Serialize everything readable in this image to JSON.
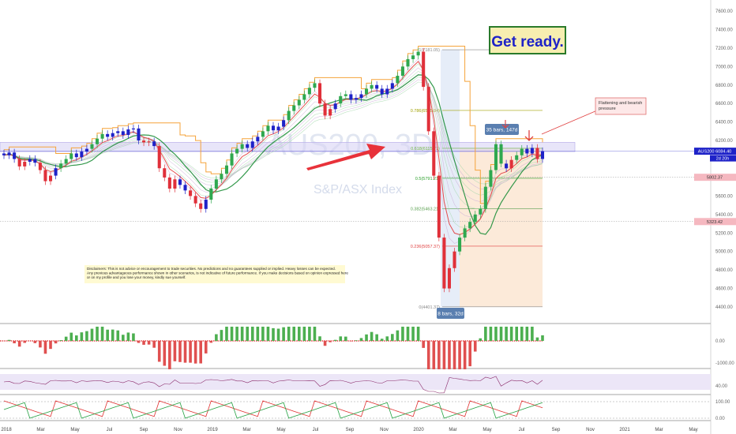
{
  "chart_data": {
    "type": "candlestick",
    "watermark": {
      "symbol": "AUS200, 3D",
      "name": "S&P/ASX Index"
    },
    "y_axis": {
      "ticks": [
        "7600.00",
        "7400.00",
        "7200.00",
        "7000.00",
        "6800.00",
        "6600.00",
        "6400.00",
        "6200.00",
        "6000.00",
        "5800.00",
        "5600.00",
        "5400.00",
        "5200.00",
        "5000.00",
        "4800.00",
        "4600.00",
        "4400.00"
      ],
      "ylim": [
        4200,
        7700
      ]
    },
    "x_axis": {
      "ticks": [
        "2018",
        "Mar",
        "May",
        "Jul",
        "Sep",
        "Nov",
        "2019",
        "Mar",
        "May",
        "Jul",
        "Sep",
        "Nov",
        "2020",
        "Mar",
        "May",
        "Jul",
        "Sep",
        "Nov",
        "2021",
        "Mar",
        "May"
      ]
    },
    "price_tags": [
      {
        "label": "AUS200",
        "value": "6084.40",
        "countdown": "2d 20h",
        "color": "#1e22c8"
      },
      {
        "label": "",
        "value": "5802.37",
        "color": "#f5b8c0"
      },
      {
        "label": "",
        "value": "5323.42",
        "color": "#f5b8c0"
      }
    ],
    "fib_levels": [
      {
        "label": "1(7181.05)",
        "value": 7181.05,
        "color": "#888888"
      },
      {
        "label": "0.786(6525.04)",
        "value": 6525.04,
        "color": "#a0a000"
      },
      {
        "label": "0.618(6115.71)",
        "value": 6115.71,
        "color": "#6cb33f"
      },
      {
        "label": "0.5(5791.21)",
        "value": 5791.21,
        "color": "#2ca02c"
      },
      {
        "label": "0.382(5463.21)",
        "value": 5463.21,
        "color": "#5aa050"
      },
      {
        "label": "0.236(5057.37)",
        "value": 5057.37,
        "color": "#e04040"
      },
      {
        "label": "0(4401.37)",
        "value": 4401.37,
        "color": "#888888"
      }
    ],
    "annotations": {
      "headline": "Get ready.",
      "callout": "Flattening and bearish pressure",
      "bars_box_top": "35 bars, 147d",
      "bars_box_bottom": "8 bars, 32d",
      "disclaimer": "Disclaimers: This is not advice or encouragement to trade securities. No predictions and no guarantees supplied or implied. Heavy losses can be expected. Any previous advantageous performance shown in other scenarios, is not indicative of future performance.  If you make decisions based on opinion expressed here or on my profile and you lose your money, kindly sue yourself."
    },
    "candles": [
      {
        "date": "2018-01",
        "o": 6060,
        "c": 6040
      },
      {
        "date": "2018-01",
        "o": 6040,
        "c": 6070
      },
      {
        "date": "2018-01",
        "o": 6070,
        "c": 6000
      },
      {
        "date": "2018-02",
        "o": 6000,
        "c": 5920
      },
      {
        "date": "2018-02",
        "o": 5920,
        "c": 5970
      },
      {
        "date": "2018-02",
        "o": 5970,
        "c": 6000
      },
      {
        "date": "2018-02",
        "o": 6000,
        "c": 5960
      },
      {
        "date": "2018-03",
        "o": 5960,
        "c": 5880
      },
      {
        "date": "2018-03",
        "o": 5880,
        "c": 5760
      },
      {
        "date": "2018-03",
        "o": 5760,
        "c": 5820
      },
      {
        "date": "2018-03",
        "o": 5820,
        "c": 5900
      },
      {
        "date": "2018-04",
        "o": 5900,
        "c": 5950
      },
      {
        "date": "2018-04",
        "o": 5950,
        "c": 6000
      },
      {
        "date": "2018-04",
        "o": 6000,
        "c": 6060
      },
      {
        "date": "2018-05",
        "o": 6060,
        "c": 6020
      },
      {
        "date": "2018-05",
        "o": 6020,
        "c": 6080
      },
      {
        "date": "2018-05",
        "o": 6080,
        "c": 6110
      },
      {
        "date": "2018-06",
        "o": 6110,
        "c": 6160
      },
      {
        "date": "2018-06",
        "o": 6160,
        "c": 6220
      },
      {
        "date": "2018-06",
        "o": 6220,
        "c": 6270
      },
      {
        "date": "2018-07",
        "o": 6270,
        "c": 6240
      },
      {
        "date": "2018-07",
        "o": 6240,
        "c": 6280
      },
      {
        "date": "2018-07",
        "o": 6280,
        "c": 6300
      },
      {
        "date": "2018-08",
        "o": 6300,
        "c": 6260
      },
      {
        "date": "2018-08",
        "o": 6260,
        "c": 6320
      },
      {
        "date": "2018-08",
        "o": 6320,
        "c": 6330
      },
      {
        "date": "2018-09",
        "o": 6330,
        "c": 6200
      },
      {
        "date": "2018-09",
        "o": 6200,
        "c": 6180
      },
      {
        "date": "2018-09",
        "o": 6180,
        "c": 6190
      },
      {
        "date": "2018-10",
        "o": 6190,
        "c": 6140
      },
      {
        "date": "2018-10",
        "o": 6140,
        "c": 5900
      },
      {
        "date": "2018-10",
        "o": 5900,
        "c": 5800
      },
      {
        "date": "2018-10",
        "o": 5800,
        "c": 5680
      },
      {
        "date": "2018-11",
        "o": 5680,
        "c": 5780
      },
      {
        "date": "2018-11",
        "o": 5780,
        "c": 5720
      },
      {
        "date": "2018-11",
        "o": 5720,
        "c": 5660
      },
      {
        "date": "2018-12",
        "o": 5660,
        "c": 5600
      },
      {
        "date": "2018-12",
        "o": 5600,
        "c": 5520
      },
      {
        "date": "2018-12",
        "o": 5520,
        "c": 5460
      },
      {
        "date": "2019-01",
        "o": 5460,
        "c": 5560
      },
      {
        "date": "2019-01",
        "o": 5560,
        "c": 5680
      },
      {
        "date": "2019-01",
        "o": 5680,
        "c": 5780
      },
      {
        "date": "2019-01",
        "o": 5780,
        "c": 5840
      },
      {
        "date": "2019-02",
        "o": 5840,
        "c": 5930
      },
      {
        "date": "2019-02",
        "o": 5930,
        "c": 6060
      },
      {
        "date": "2019-02",
        "o": 6060,
        "c": 6110
      },
      {
        "date": "2019-03",
        "o": 6110,
        "c": 6160
      },
      {
        "date": "2019-03",
        "o": 6160,
        "c": 6120
      },
      {
        "date": "2019-03",
        "o": 6120,
        "c": 6190
      },
      {
        "date": "2019-04",
        "o": 6190,
        "c": 6240
      },
      {
        "date": "2019-04",
        "o": 6240,
        "c": 6300
      },
      {
        "date": "2019-04",
        "o": 6300,
        "c": 6360
      },
      {
        "date": "2019-05",
        "o": 6360,
        "c": 6310
      },
      {
        "date": "2019-05",
        "o": 6310,
        "c": 6350
      },
      {
        "date": "2019-05",
        "o": 6350,
        "c": 6420
      },
      {
        "date": "2019-06",
        "o": 6420,
        "c": 6520
      },
      {
        "date": "2019-06",
        "o": 6520,
        "c": 6580
      },
      {
        "date": "2019-06",
        "o": 6580,
        "c": 6640
      },
      {
        "date": "2019-07",
        "o": 6640,
        "c": 6700
      },
      {
        "date": "2019-07",
        "o": 6700,
        "c": 6770
      },
      {
        "date": "2019-07",
        "o": 6770,
        "c": 6820
      },
      {
        "date": "2019-08",
        "o": 6820,
        "c": 6600
      },
      {
        "date": "2019-08",
        "o": 6600,
        "c": 6470
      },
      {
        "date": "2019-08",
        "o": 6470,
        "c": 6540
      },
      {
        "date": "2019-09",
        "o": 6540,
        "c": 6600
      },
      {
        "date": "2019-09",
        "o": 6600,
        "c": 6680
      },
      {
        "date": "2019-09",
        "o": 6680,
        "c": 6700
      },
      {
        "date": "2019-10",
        "o": 6700,
        "c": 6640
      },
      {
        "date": "2019-10",
        "o": 6640,
        "c": 6660
      },
      {
        "date": "2019-10",
        "o": 6660,
        "c": 6700
      },
      {
        "date": "2019-11",
        "o": 6700,
        "c": 6760
      },
      {
        "date": "2019-11",
        "o": 6760,
        "c": 6800
      },
      {
        "date": "2019-11",
        "o": 6800,
        "c": 6760
      },
      {
        "date": "2019-12",
        "o": 6760,
        "c": 6700
      },
      {
        "date": "2019-12",
        "o": 6700,
        "c": 6760
      },
      {
        "date": "2019-12",
        "o": 6760,
        "c": 6820
      },
      {
        "date": "2020-01",
        "o": 6820,
        "c": 6900
      },
      {
        "date": "2020-01",
        "o": 6900,
        "c": 7000
      },
      {
        "date": "2020-01",
        "o": 7000,
        "c": 7080
      },
      {
        "date": "2020-02",
        "o": 7080,
        "c": 7120
      },
      {
        "date": "2020-02",
        "o": 7120,
        "c": 7160
      },
      {
        "date": "2020-02",
        "o": 7160,
        "c": 6780
      },
      {
        "date": "2020-03",
        "o": 6780,
        "c": 6300
      },
      {
        "date": "2020-03",
        "o": 6300,
        "c": 5820
      },
      {
        "date": "2020-03",
        "o": 5820,
        "c": 5150
      },
      {
        "date": "2020-03",
        "o": 5150,
        "c": 4600
      },
      {
        "date": "2020-04",
        "o": 4600,
        "c": 4820
      },
      {
        "date": "2020-04",
        "o": 4820,
        "c": 5000
      },
      {
        "date": "2020-04",
        "o": 5000,
        "c": 5150
      },
      {
        "date": "2020-04",
        "o": 5150,
        "c": 5250
      },
      {
        "date": "2020-05",
        "o": 5250,
        "c": 5320
      },
      {
        "date": "2020-05",
        "o": 5320,
        "c": 5400
      },
      {
        "date": "2020-05",
        "o": 5400,
        "c": 5460
      },
      {
        "date": "2020-06",
        "o": 5460,
        "c": 5700
      },
      {
        "date": "2020-06",
        "o": 5700,
        "c": 5880
      },
      {
        "date": "2020-06",
        "o": 5880,
        "c": 6160
      },
      {
        "date": "2020-06",
        "o": 6160,
        "c": 5950
      },
      {
        "date": "2020-07",
        "o": 5950,
        "c": 5900
      },
      {
        "date": "2020-07",
        "o": 5900,
        "c": 5990
      },
      {
        "date": "2020-07",
        "o": 5990,
        "c": 6040
      },
      {
        "date": "2020-07",
        "o": 6040,
        "c": 6110
      },
      {
        "date": "2020-08",
        "o": 6110,
        "c": 6060
      },
      {
        "date": "2020-08",
        "o": 6060,
        "c": 6120
      },
      {
        "date": "2020-08",
        "o": 6120,
        "c": 6000
      },
      {
        "date": "2020-08",
        "o": 6000,
        "c": 6084.4
      }
    ],
    "indicators": [
      {
        "name": "momentum-histogram",
        "y_ticks": [
          "0.00",
          "-1000.00"
        ]
      },
      {
        "name": "oscillator",
        "y_ticks": [
          "40.00"
        ]
      },
      {
        "name": "stochastic",
        "y_ticks": [
          "100.00",
          "0.00"
        ]
      }
    ],
    "colors": {
      "bull": "#2fa84f",
      "bear": "#e0303a",
      "neutral": "#1e22c8",
      "band": "#f5a33a",
      "sma": "#1f8f3a",
      "ema": "#e03030",
      "headline_bg": "#f7eeb0",
      "headline_text": "#1e22c8",
      "headline_border": "#2a7a2a"
    }
  }
}
